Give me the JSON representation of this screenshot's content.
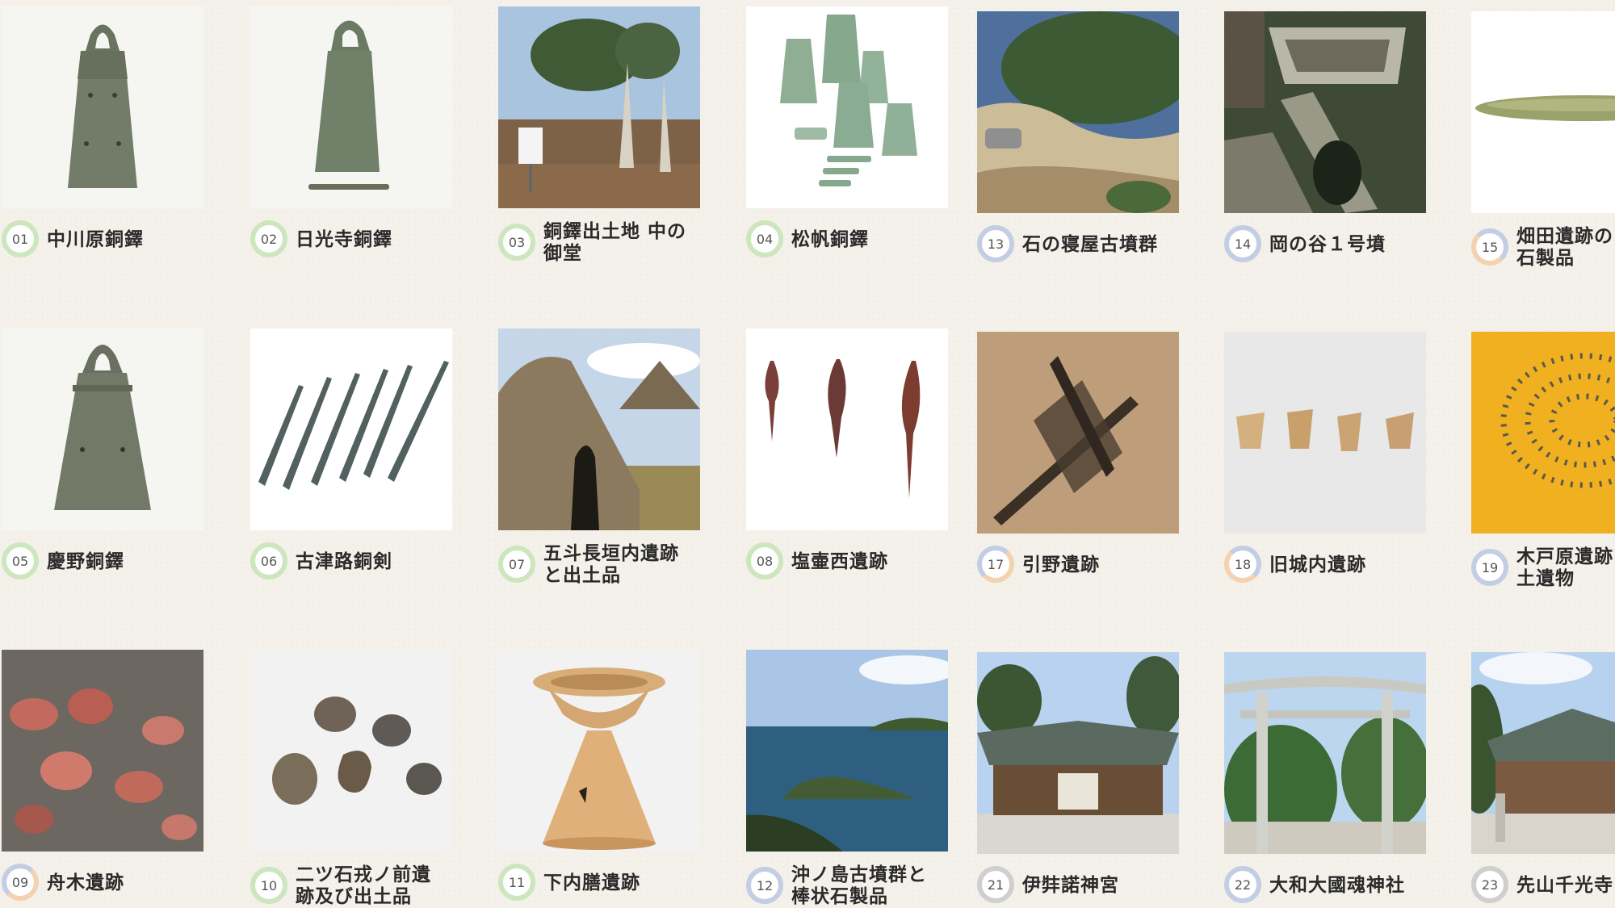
{
  "items": [
    {
      "num": "01",
      "title": "中川原銅鐸"
    },
    {
      "num": "02",
      "title": "日光寺銅鐸"
    },
    {
      "num": "03",
      "title": "銅鐸出土地 中の\n御堂"
    },
    {
      "num": "04",
      "title": "松帆銅鐸"
    },
    {
      "num": "13",
      "title": "石の寝屋古墳群"
    },
    {
      "num": "14",
      "title": "岡の谷１号墳"
    },
    {
      "num": "15",
      "title": "畑田遺跡の\n石製品"
    },
    {
      "num": "05",
      "title": "慶野銅鐸"
    },
    {
      "num": "06",
      "title": "古津路銅剣"
    },
    {
      "num": "07",
      "title": "五斗長垣内遺跡\nと出土品"
    },
    {
      "num": "08",
      "title": "塩壷西遺跡"
    },
    {
      "num": "17",
      "title": "引野遺跡"
    },
    {
      "num": "18",
      "title": "旧城内遺跡"
    },
    {
      "num": "19",
      "title": "木戸原遺跡\n土遺物"
    },
    {
      "num": "09",
      "title": "舟木遺跡"
    },
    {
      "num": "10",
      "title": "二ツ石戎ノ前遺\n跡及び出土品"
    },
    {
      "num": "11",
      "title": "下内膳遺跡"
    },
    {
      "num": "12",
      "title": "沖ノ島古墳群と\n棒状石製品"
    },
    {
      "num": "21",
      "title": "伊弉諾神宮"
    },
    {
      "num": "22",
      "title": "大和大國魂神社"
    },
    {
      "num": "23",
      "title": "先山千光寺"
    }
  ]
}
